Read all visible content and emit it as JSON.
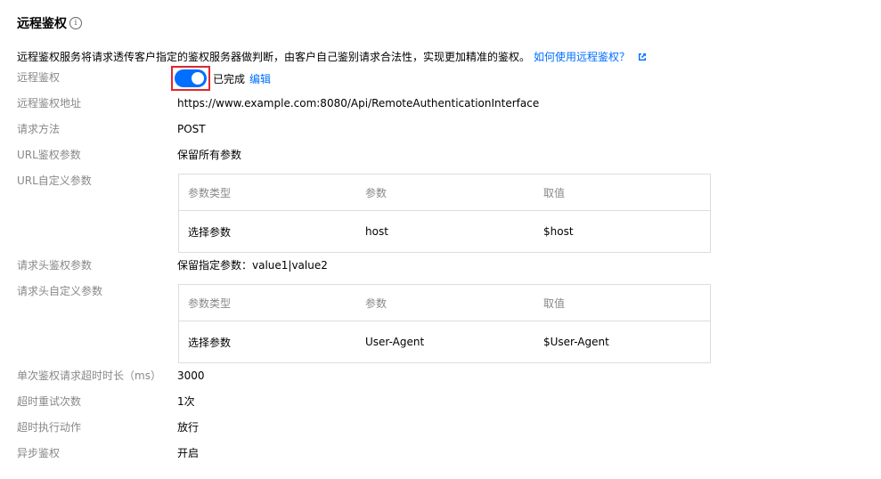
{
  "section": {
    "title": "远程鉴权",
    "info_icon": "ⓘ"
  },
  "description": {
    "text": "远程鉴权服务将请求透传客户指定的鉴权服务器做判断，由客户自己鉴别请求合法性，实现更加精准的鉴权。",
    "help_link": "如何使用远程鉴权？"
  },
  "remote_auth": {
    "label": "远程鉴权",
    "enabled": true,
    "status": "已完成",
    "edit": "编辑"
  },
  "fields": {
    "address": {
      "label": "远程鉴权地址",
      "value": "https://www.example.com:8080/Api/RemoteAuthenticationInterface"
    },
    "method": {
      "label": "请求方法",
      "value": "POST"
    },
    "url_params": {
      "label": "URL鉴权参数",
      "value": "保留所有参数"
    },
    "url_custom": {
      "label": "URL自定义参数"
    },
    "header_params": {
      "label": "请求头鉴权参数",
      "value": "保留指定参数：value1|value2"
    },
    "header_custom": {
      "label": "请求头自定义参数"
    },
    "timeout": {
      "label": "单次鉴权请求超时时长（ms）",
      "value": "3000"
    },
    "retry": {
      "label": "超时重试次数",
      "value": "1次"
    },
    "timeout_action": {
      "label": "超时执行动作",
      "value": "放行"
    },
    "async": {
      "label": "异步鉴权",
      "value": "开启"
    }
  },
  "url_table": {
    "headers": [
      "参数类型",
      "参数",
      "取值"
    ],
    "rows": [
      [
        "选择参数",
        "host",
        "$host"
      ]
    ]
  },
  "header_table": {
    "headers": [
      "参数类型",
      "参数",
      "取值"
    ],
    "rows": [
      [
        "选择参数",
        "User-Agent",
        "$User-Agent"
      ]
    ]
  },
  "colors": {
    "accent": "#006eff",
    "highlight_border": "#e0262d"
  }
}
